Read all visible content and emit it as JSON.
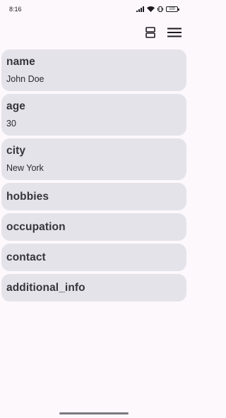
{
  "status_bar": {
    "time": "8:16",
    "battery_level": "100"
  },
  "app_bar": {
    "icons": [
      "view-agenda-icon",
      "menu-icon"
    ]
  },
  "items": [
    {
      "key": "name",
      "value": "John Doe"
    },
    {
      "key": "age",
      "value": "30"
    },
    {
      "key": "city",
      "value": "New York"
    },
    {
      "key": "hobbies"
    },
    {
      "key": "occupation"
    },
    {
      "key": "contact"
    },
    {
      "key": "additional_info"
    }
  ]
}
